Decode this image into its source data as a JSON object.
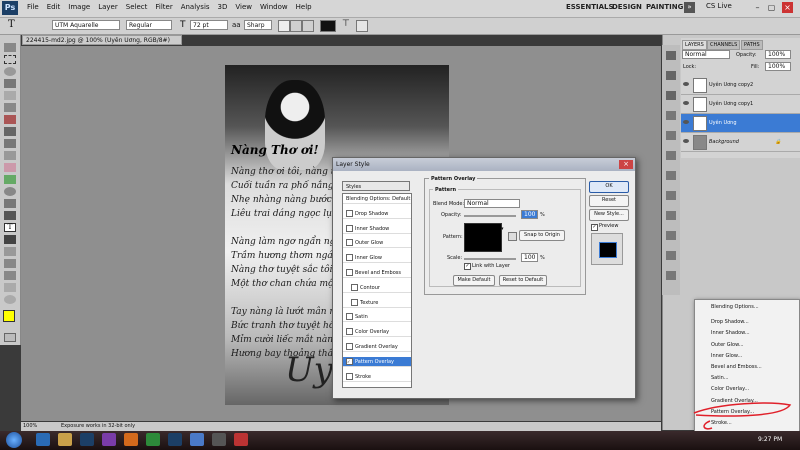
{
  "app": {
    "logo": "Ps"
  },
  "menu": [
    "File",
    "Edit",
    "Image",
    "Layer",
    "Select",
    "Filter",
    "Analysis",
    "3D",
    "View",
    "Window",
    "Help"
  ],
  "workspaces": [
    "ESSENTIALS",
    "DESIGN",
    "PAINTING"
  ],
  "cs_live": "CS Live",
  "options": {
    "font_family": "UTM Aquarelle",
    "font_style": "Regular",
    "font_size": "72 pt",
    "anti_alias": "Sharp"
  },
  "document_tab": "224415-md2.jpg @ 100% (Uyên Uơng, RGB/8#)",
  "status": {
    "zoom": "100%",
    "info": "Exposure works in 32-bit only"
  },
  "artwork": {
    "title": "Nàng Thơ ơi!",
    "poem": "Nàng thơ ơi tôi, nàng thơ\nCuối tuần ra phố nắng đùa\nNhẹ nhàng nàng bước bên\nLiêu trai dáng ngọc lụa mỏ\n\nNàng làm ngơ ngẩn người\nTrầm hương thơm ngát tỏa\nNàng thơ tuyệt sắc tôi rồi\nMột thơ chan chứa một trờ\n\nTay nàng là lướt mân mê\nBức tranh thơ tuyệt hồn mà\nMỉm cười liếc mắt nàng\nHương bay thoảng thầm miệng",
    "signature": "Uy"
  },
  "layers_panel": {
    "tabs": [
      "LAYERS",
      "CHANNELS",
      "PATHS"
    ],
    "blend": "Normal",
    "opacity_label": "Opacity:",
    "opacity": "100%",
    "lock_label": "Lock:",
    "fill_label": "Fill:",
    "fill": "100%",
    "layers": [
      {
        "name": "Uyên Uơng copy2",
        "selected": false
      },
      {
        "name": "Uyên Uơng copy1",
        "selected": false
      },
      {
        "name": "Uyên Uơng",
        "selected": true
      },
      {
        "name": "Background",
        "selected": false
      }
    ]
  },
  "dialog": {
    "title": "Layer Style",
    "styles_header": "Styles",
    "styles": [
      {
        "label": "Blending Options: Default",
        "cb": false,
        "sub": false,
        "sel": false
      },
      {
        "label": "Drop Shadow",
        "cb": true,
        "sub": false,
        "sel": false
      },
      {
        "label": "Inner Shadow",
        "cb": true,
        "sub": false,
        "sel": false
      },
      {
        "label": "Outer Glow",
        "cb": true,
        "sub": false,
        "sel": false
      },
      {
        "label": "Inner Glow",
        "cb": true,
        "sub": false,
        "sel": false
      },
      {
        "label": "Bevel and Emboss",
        "cb": true,
        "sub": false,
        "sel": false
      },
      {
        "label": "Contour",
        "cb": true,
        "sub": true,
        "sel": false
      },
      {
        "label": "Texture",
        "cb": true,
        "sub": true,
        "sel": false
      },
      {
        "label": "Satin",
        "cb": true,
        "sub": false,
        "sel": false
      },
      {
        "label": "Color Overlay",
        "cb": true,
        "sub": false,
        "sel": false
      },
      {
        "label": "Gradient Overlay",
        "cb": true,
        "sub": false,
        "sel": false
      },
      {
        "label": "Pattern Overlay",
        "cb": true,
        "sub": false,
        "sel": true
      },
      {
        "label": "Stroke",
        "cb": true,
        "sub": false,
        "sel": false
      }
    ],
    "group_title": "Pattern Overlay",
    "subgroup_title": "Pattern",
    "blend_mode_label": "Blend Mode:",
    "blend_mode": "Normal",
    "opacity_label": "Opacity:",
    "opacity": "100",
    "pattern_label": "Pattern:",
    "snap_button": "Snap to Origin",
    "scale_label": "Scale:",
    "scale": "100",
    "percent": "%",
    "link_label": "Link with Layer",
    "make_default": "Make Default",
    "reset_default": "Reset to Default",
    "ok": "OK",
    "reset": "Reset",
    "new_style": "New Style...",
    "preview": "Preview"
  },
  "context_menu": [
    "Blending Options...",
    "Drop Shadow...",
    "Inner Shadow...",
    "Outer Glow...",
    "Inner Glow...",
    "Bevel and Emboss...",
    "Satin...",
    "Color Overlay...",
    "Gradient Overlay...",
    "Pattern Overlay...",
    "Stroke..."
  ],
  "taskbar": {
    "time": "9:27 PM"
  },
  "colors": {
    "selection_blue": "#3b7bd4",
    "fg_swatch": "#ffff00",
    "annotation_red": "#e0202a"
  }
}
